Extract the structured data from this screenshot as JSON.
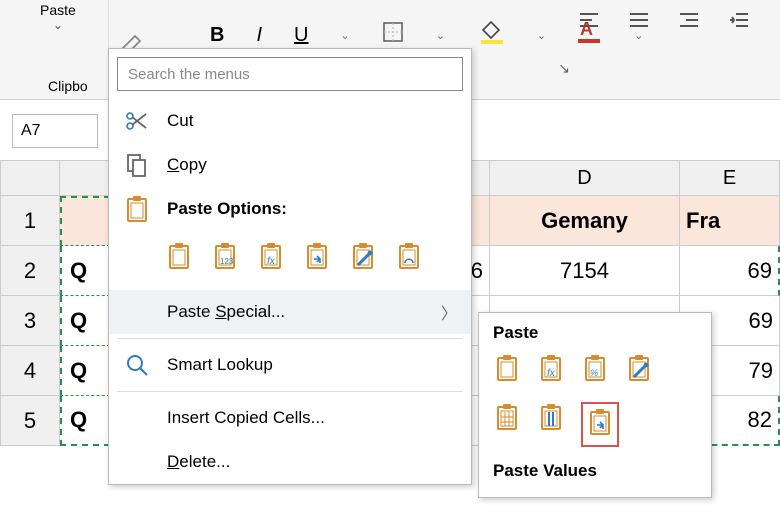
{
  "ribbon": {
    "paste_label": "Paste",
    "clipboard_label": "Clipbo"
  },
  "namebox": {
    "value": "A7"
  },
  "columns": {
    "D": "D",
    "E_partial": "E"
  },
  "header_row": {
    "D": "Gemany",
    "E": "Fra"
  },
  "rows": [
    {
      "num": "1",
      "A": "",
      "D": "",
      "E": ""
    },
    {
      "num": "2",
      "A": "Q",
      "D": "7154",
      "E": "69",
      "pre_D": "6"
    },
    {
      "num": "3",
      "A": "Q",
      "D": "",
      "E": "69"
    },
    {
      "num": "4",
      "A": "Q",
      "D": "",
      "E": "79"
    },
    {
      "num": "5",
      "A": "Q",
      "D": "",
      "E": "82"
    }
  ],
  "ctx": {
    "search_placeholder": "Search the menus",
    "cut": "Cut",
    "copy": "Copy",
    "paste_options": "Paste Options:",
    "paste_special": "Paste Special...",
    "smart_lookup": "Smart Lookup",
    "insert_copied": "Insert Copied Cells...",
    "delete": "Delete..."
  },
  "submenu": {
    "paste_hdr": "Paste",
    "paste_values_hdr": "Paste Values"
  }
}
